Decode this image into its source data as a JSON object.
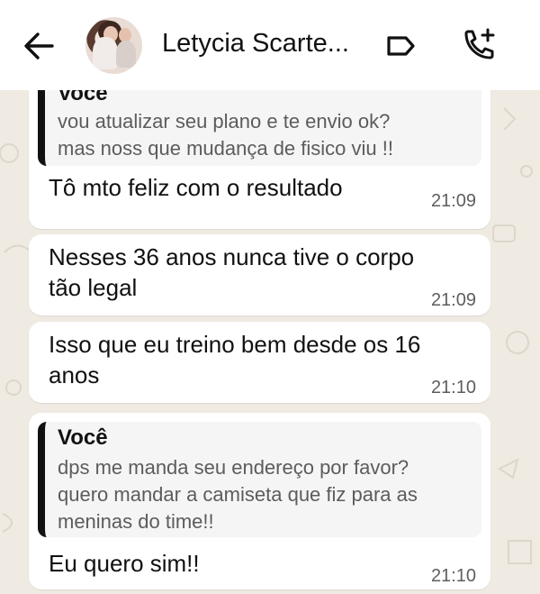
{
  "header": {
    "contact_name": "Letycia Scarte...",
    "icons": {
      "back": "back-arrow-icon",
      "label": "label-tag-icon",
      "call": "add-call-icon"
    }
  },
  "messages": [
    {
      "quote": {
        "author": "Você",
        "lines": [
          "vou atualizar seu plano e te envio ok?",
          "mas noss que mudança de fisico viu !!"
        ]
      },
      "text_lines": [
        "Tô mto feliz com o resultado"
      ],
      "time": "21:09"
    },
    {
      "text_lines": [
        "Nesses 36 anos nunca tive o corpo",
        "tão legal"
      ],
      "time": "21:09"
    },
    {
      "text_lines": [
        "Isso que eu treino bem desde os 16",
        "anos"
      ],
      "time": "21:10"
    },
    {
      "quote": {
        "author": "Você",
        "lines": [
          "dps me manda seu endereço por favor?",
          "quero mandar a camiseta que fiz para as",
          "meninas do time!!"
        ]
      },
      "text_lines": [
        "Eu quero sim!!"
      ],
      "time": "21:10"
    }
  ],
  "colors": {
    "chat_bg": "#efeae2",
    "bubble": "#ffffff",
    "quote_bar": "#111111",
    "quote_bg": "#f5f5f5"
  }
}
